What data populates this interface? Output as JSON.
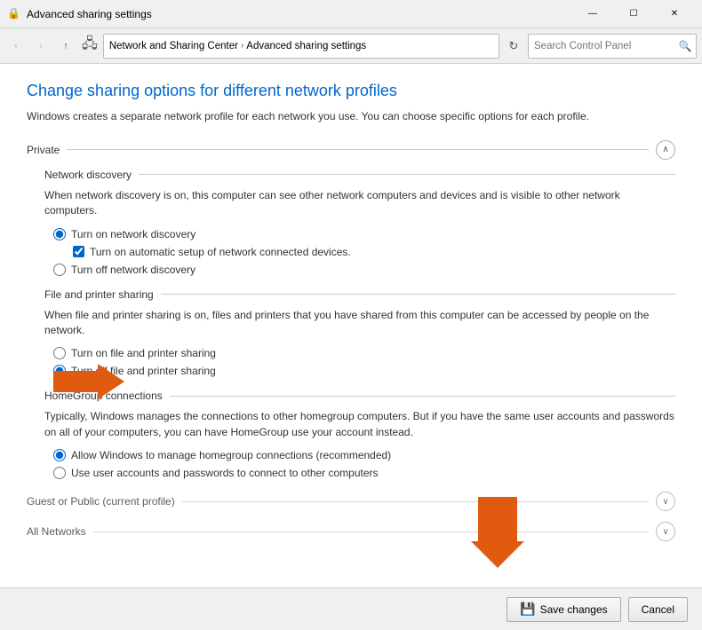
{
  "window": {
    "title": "Advanced sharing settings",
    "icon": "🔒"
  },
  "titlebar": {
    "controls": {
      "minimize": "—",
      "maximize": "☐",
      "close": "✕"
    }
  },
  "addressbar": {
    "nav": {
      "back": "‹",
      "forward": "›",
      "up": "↑"
    },
    "breadcrumbs": [
      {
        "label": "Network and Sharing Center",
        "sep": "›"
      },
      {
        "label": "Advanced sharing settings"
      }
    ],
    "search_placeholder": "Search Control Panel"
  },
  "page": {
    "title": "Change sharing options for different network profiles",
    "description": "Windows creates a separate network profile for each network you use. You can choose specific options for each profile.",
    "sections": [
      {
        "id": "private",
        "label": "Private",
        "expanded": true,
        "toggle_symbol": "∧",
        "subsections": [
          {
            "id": "network-discovery",
            "label": "Network discovery",
            "description": "When network discovery is on, this computer can see other network computers and devices and is visible to other network computers.",
            "options": [
              {
                "type": "radio",
                "name": "discovery",
                "id": "discovery-on",
                "checked": true,
                "label": "Turn on network discovery"
              },
              {
                "type": "checkbox",
                "name": "auto-setup",
                "id": "auto-setup",
                "checked": true,
                "label": "Turn on automatic setup of network connected devices.",
                "indent": true
              },
              {
                "type": "radio",
                "name": "discovery",
                "id": "discovery-off",
                "checked": false,
                "label": "Turn off network discovery"
              }
            ]
          },
          {
            "id": "file-printer-sharing",
            "label": "File and printer sharing",
            "description": "When file and printer sharing is on, files and printers that you have shared from this computer can be accessed by people on the network.",
            "options": [
              {
                "type": "radio",
                "name": "sharing",
                "id": "sharing-on",
                "checked": false,
                "label": "Turn on file and printer sharing"
              },
              {
                "type": "radio",
                "name": "sharing",
                "id": "sharing-off",
                "checked": true,
                "label": "Turn off file and printer sharing"
              }
            ]
          },
          {
            "id": "homegroup",
            "label": "HomeGroup connections",
            "description": "Typically, Windows manages the connections to other homegroup computers. But if you have the same user accounts and passwords on all of your computers, you can have HomeGroup use your account instead.",
            "options": [
              {
                "type": "radio",
                "name": "homegroup",
                "id": "homegroup-windows",
                "checked": true,
                "label": "Allow Windows to manage homegroup connections (recommended)"
              },
              {
                "type": "radio",
                "name": "homegroup",
                "id": "homegroup-user",
                "checked": false,
                "label": "Use user accounts and passwords to connect to other computers"
              }
            ]
          }
        ]
      },
      {
        "id": "guest-public",
        "label": "Guest or Public (current profile)",
        "expanded": false,
        "toggle_symbol": "∨"
      },
      {
        "id": "all-networks",
        "label": "All Networks",
        "expanded": false,
        "toggle_symbol": "∨"
      }
    ]
  },
  "bottombar": {
    "save_label": "Save changes",
    "cancel_label": "Cancel",
    "save_icon": "💾"
  }
}
